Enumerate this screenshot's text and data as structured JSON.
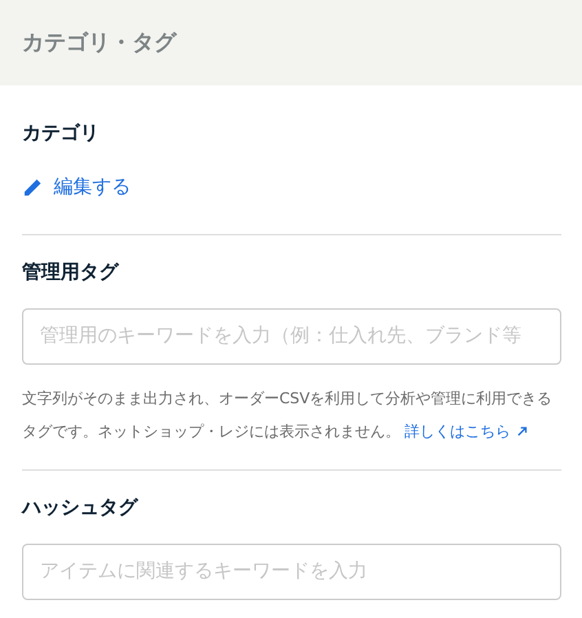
{
  "header": {
    "title": "カテゴリ・タグ"
  },
  "category": {
    "heading": "カテゴリ",
    "edit_link": "編集する"
  },
  "admin_tag": {
    "heading": "管理用タグ",
    "placeholder": "管理用のキーワードを入力（例：仕入れ先、ブランド等",
    "help": "文字列がそのまま出力され、オーダーCSVを利用して分析や管理に利用できるタグです。ネットショップ・レジには表示されません。",
    "help_link": "詳しくはこちら"
  },
  "hashtag": {
    "heading": "ハッシュタグ",
    "placeholder": "アイテムに関連するキーワードを入力"
  }
}
